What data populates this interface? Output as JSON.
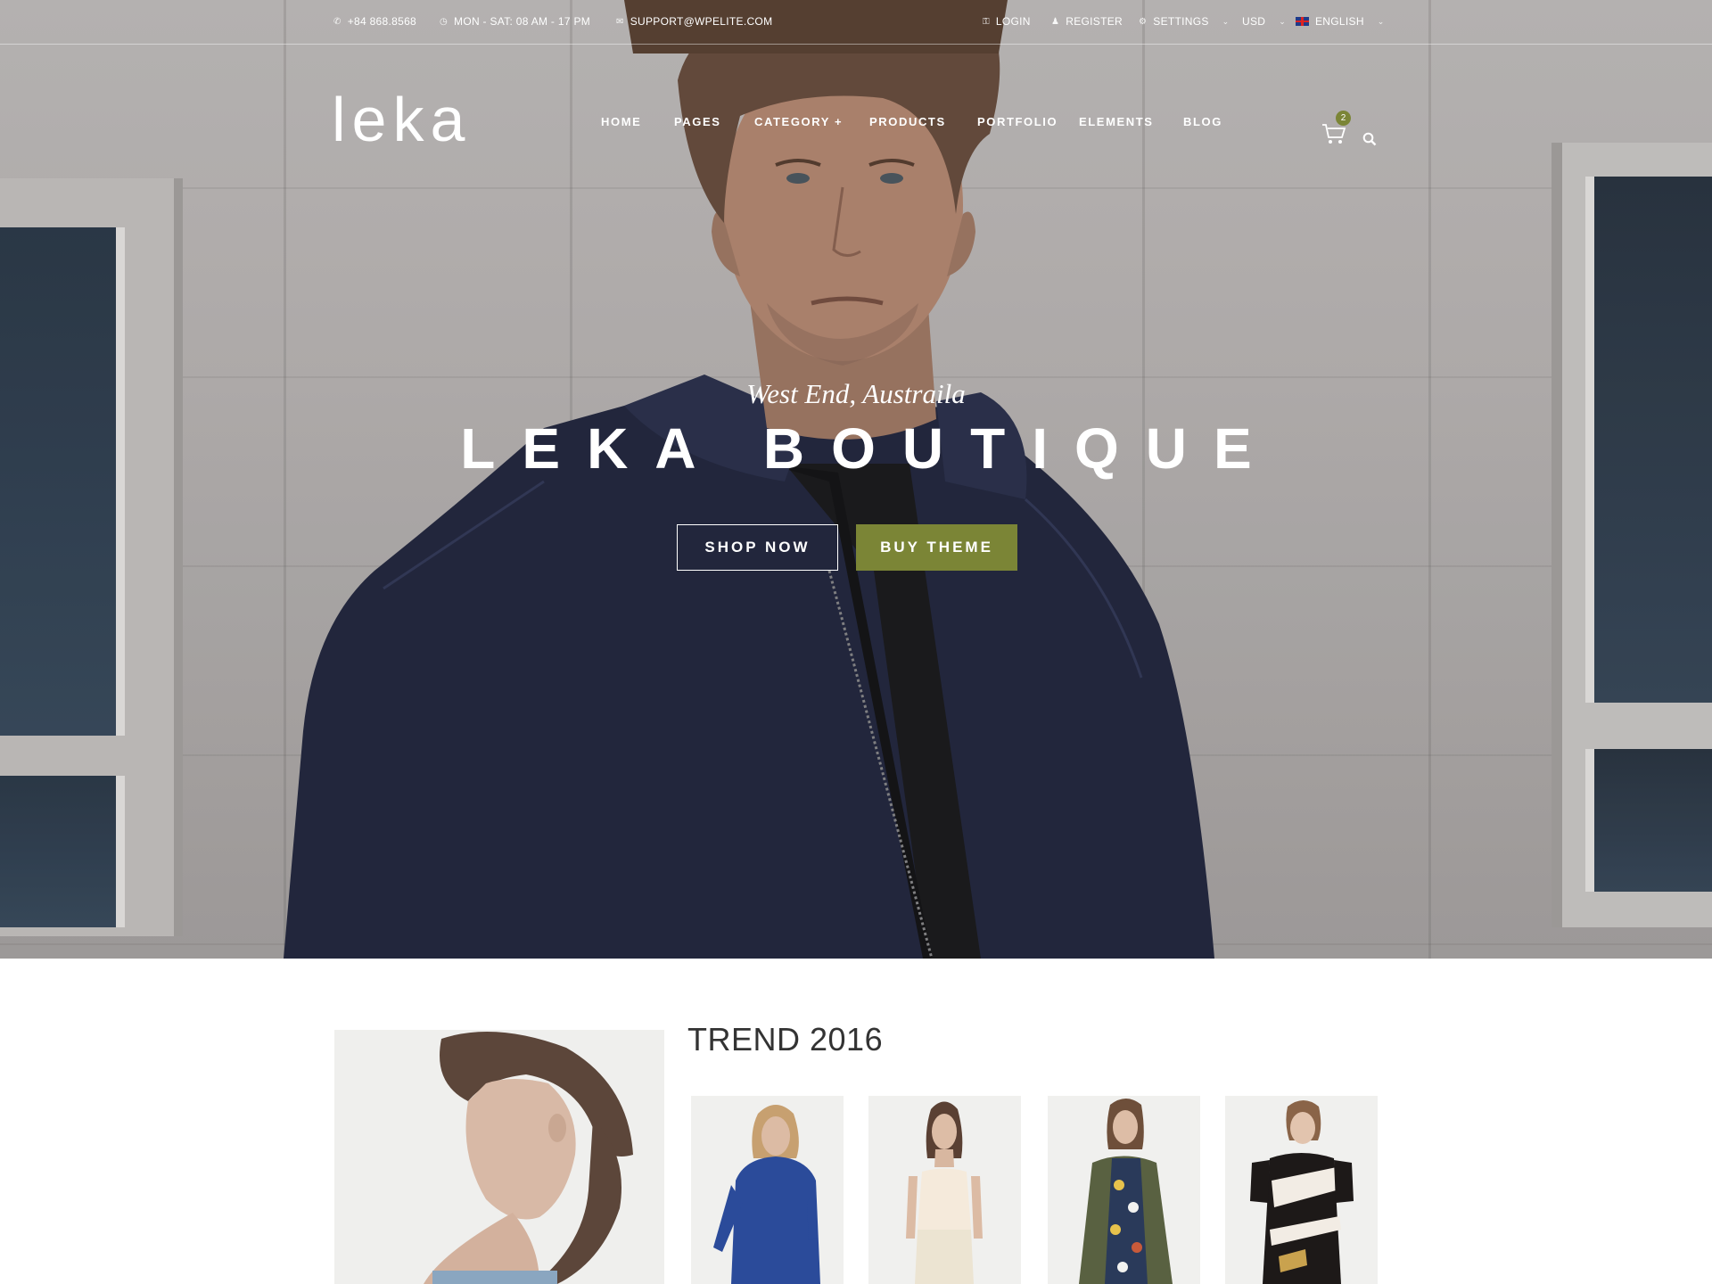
{
  "topbar": {
    "phone": "+84 868.8568",
    "hours": "MON - SAT: 08 AM - 17 PM",
    "email": "SUPPORT@WPELITE.COM",
    "login": "LOGIN",
    "register": "REGISTER",
    "settings": "SETTINGS",
    "currency": "USD",
    "language": "ENGLISH"
  },
  "header": {
    "logo": "leka",
    "nav": [
      "HOME",
      "PAGES",
      "CATEGORY +",
      "PRODUCTS",
      "PORTFOLIO",
      "ELEMENTS",
      "BLOG"
    ],
    "cart_count": "2"
  },
  "hero": {
    "subtitle": "West End, Austraila",
    "title": "LEKA BOUTIQUE",
    "shop_label": "SHOP NOW",
    "buy_label": "BUY THEME"
  },
  "trend": {
    "title": "TREND 2016"
  },
  "colors": {
    "accent": "#7b8536",
    "hero_overlay_text": "#ffffff"
  },
  "icons": [
    "phone-icon",
    "clock-icon",
    "envelope-icon",
    "key-icon",
    "user-icon",
    "gear-icon",
    "chevron-down-icon",
    "uk-flag-icon",
    "cart-icon",
    "search-icon"
  ]
}
